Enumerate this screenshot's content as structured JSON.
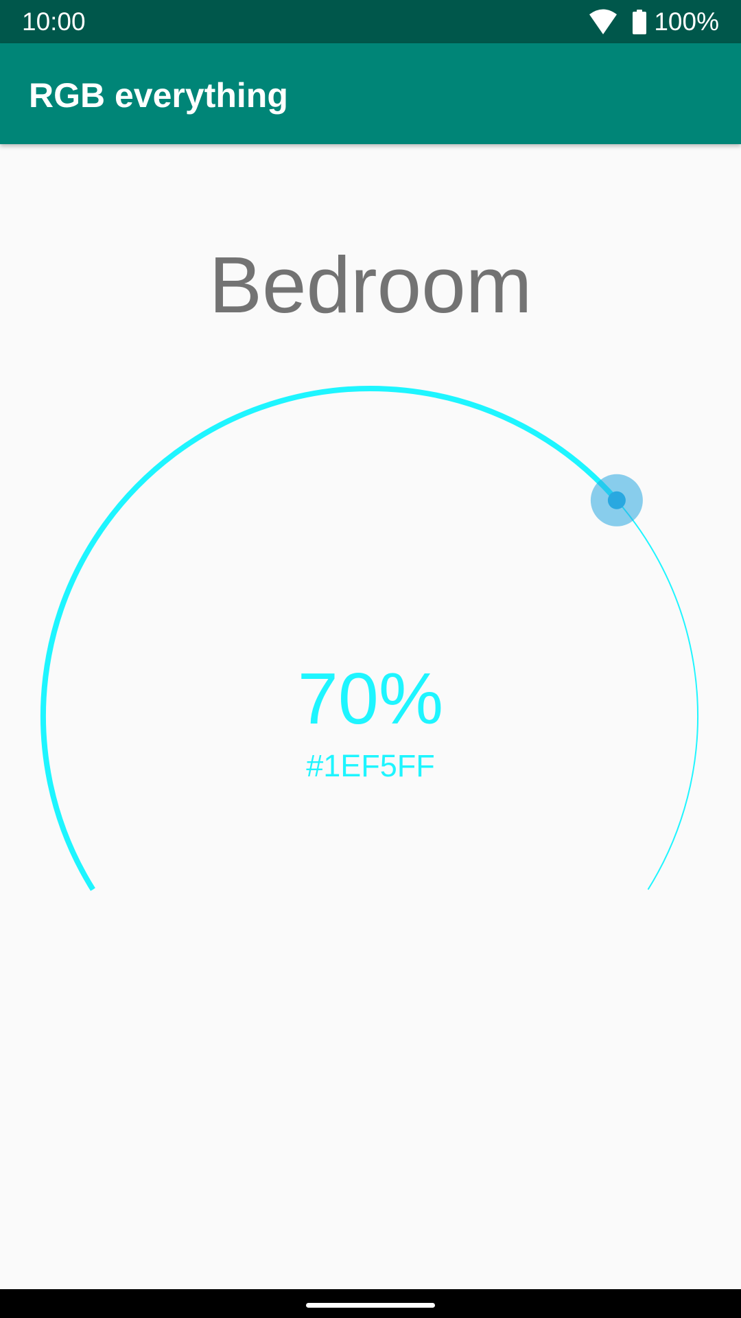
{
  "status_bar": {
    "time": "10:00",
    "battery_percent": "100%",
    "icons": [
      "wifi-icon",
      "battery-icon"
    ]
  },
  "app_bar": {
    "title": "RGB everything"
  },
  "room": {
    "name": "Bedroom"
  },
  "dial": {
    "brightness_label": "70%",
    "brightness_value": 0.7,
    "color_hex": "#1EF5FF"
  },
  "colors": {
    "status_bar": "#00574B",
    "app_bar": "#008577",
    "accent": "#1EF5FF",
    "thumb": "#29A8E0",
    "background": "#FAFAFA"
  }
}
